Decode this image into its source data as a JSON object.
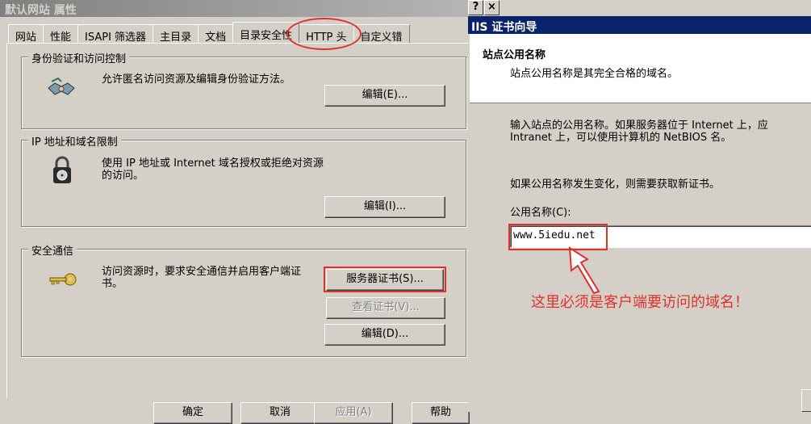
{
  "left_dialog": {
    "title": "默认网站 属性",
    "tabs": [
      "网站",
      "性能",
      "ISAPI 筛选器",
      "主目录",
      "文档",
      "目录安全性",
      "HTTP 头",
      "自定义错"
    ],
    "active_tab_index": 5,
    "groups": {
      "auth": {
        "title": "身份验证和访问控制",
        "description": "允许匿名访问资源及编辑身份验证方法。",
        "edit_button": "编辑(E)..."
      },
      "ip": {
        "title": "IP 地址和域名限制",
        "description": "使用 IP 地址或 Internet 域名授权或拒绝对资源的访问。",
        "edit_button": "编辑(I)..."
      },
      "secure": {
        "title": "安全通信",
        "description": "访问资源时，要求安全通信并启用客户端证书。",
        "server_cert_button": "服务器证书(S)...",
        "view_cert_button": "查看证书(V)...",
        "edit_button": "编辑(D)..."
      }
    },
    "bottom_buttons": {
      "ok": "确定",
      "cancel": "取消",
      "apply": "应用(A)",
      "help": "帮助"
    }
  },
  "wizard": {
    "control_buttons": [
      "?",
      "×"
    ],
    "title": "IIS 证书向导",
    "header_title": "站点公用名称",
    "header_subtitle": "站点公用名称是其完全合格的域名。",
    "instruction_line1": "输入站点的公用名称。如果服务器位于 Internet 上，应",
    "instruction_line2": "Intranet 上，可以使用计算机的 NetBIOS 名。",
    "warning": "如果公用名称发生变化，则需要获取新证书。",
    "field_label": "公用名称(C):",
    "field_value": "www.5iedu.net"
  },
  "annotation_text": "这里必须是客户端要访问的域名！",
  "colors": {
    "highlight": "#e0312b",
    "dialog_bg": "#d4d0c8",
    "active_title": "#0a246a"
  }
}
